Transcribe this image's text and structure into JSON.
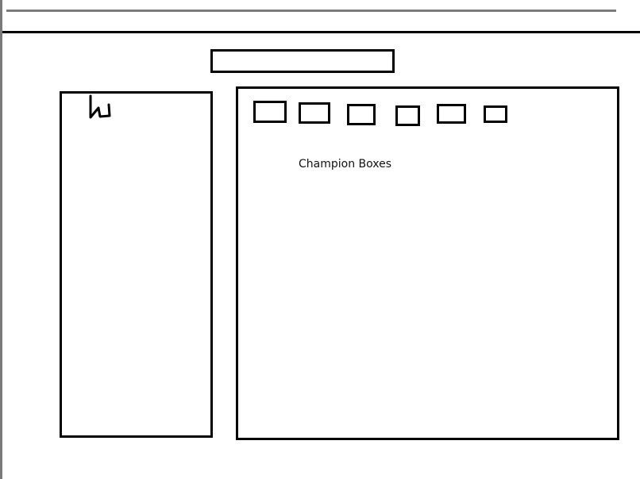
{
  "main": {
    "caption": "Champion Boxes"
  },
  "left_panel": {
    "mark_icon": "handwritten-w-icon"
  },
  "champion_boxes": {
    "count": 6,
    "icon": "square-outline"
  }
}
